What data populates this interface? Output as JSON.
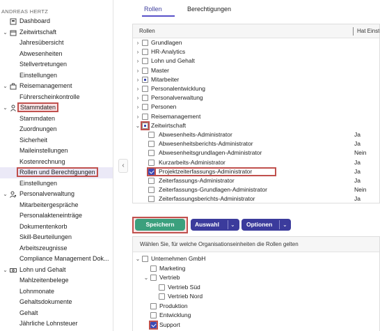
{
  "user": {
    "name": "ANDREAS HERTZ"
  },
  "sidebar": {
    "items": [
      {
        "label": "Dashboard",
        "icon": "dashboard-icon",
        "level": "top"
      },
      {
        "label": "Zeitwirtschaft",
        "icon": "calendar-clock-icon",
        "level": "top",
        "expandable": true
      },
      {
        "label": "Jahresübersicht",
        "level": "sub"
      },
      {
        "label": "Abwesenheiten",
        "level": "sub"
      },
      {
        "label": "Stellvertretungen",
        "level": "sub"
      },
      {
        "label": "Einstellungen",
        "level": "sub"
      },
      {
        "label": "Reisemanagement",
        "icon": "suitcase-icon",
        "level": "top",
        "expandable": true
      },
      {
        "label": "Führerscheinkontrolle",
        "level": "sub"
      },
      {
        "label": "Stammdaten",
        "icon": "person-icon",
        "level": "top",
        "expandable": true,
        "highlight": true
      },
      {
        "label": "Stammdaten",
        "level": "sub"
      },
      {
        "label": "Zuordnungen",
        "level": "sub"
      },
      {
        "label": "Sicherheit",
        "level": "sub"
      },
      {
        "label": "Maileinstellungen",
        "level": "sub"
      },
      {
        "label": "Kostenrechnung",
        "level": "sub"
      },
      {
        "label": "Rollen und Berechtigungen",
        "level": "sub",
        "selected": true
      },
      {
        "label": "Einstellungen",
        "level": "sub"
      },
      {
        "label": "Personalverwaltung",
        "icon": "person-settings-icon",
        "level": "top",
        "expandable": true
      },
      {
        "label": "Mitarbeitergespräche",
        "level": "sub"
      },
      {
        "label": "Personalakteneinträge",
        "level": "sub"
      },
      {
        "label": "Dokumentenkorb",
        "level": "sub"
      },
      {
        "label": "Skill-Beurteilungen",
        "level": "sub"
      },
      {
        "label": "Arbeitszeugnisse",
        "level": "sub"
      },
      {
        "label": "Compliance Management Dok...",
        "level": "sub"
      },
      {
        "label": "Lohn und Gehalt",
        "icon": "money-icon",
        "level": "top",
        "expandable": true
      },
      {
        "label": "Mahlzeitenbelege",
        "level": "sub"
      },
      {
        "label": "Lohnmonate",
        "level": "sub"
      },
      {
        "label": "Gehaltsdokumente",
        "level": "sub"
      },
      {
        "label": "Gehalt",
        "level": "sub"
      },
      {
        "label": "Jährliche Lohnsteuer",
        "level": "sub"
      }
    ]
  },
  "collapse": {
    "glyph": "‹"
  },
  "tabs": [
    {
      "label": "Rollen",
      "active": true
    },
    {
      "label": "Berechtigungen",
      "active": false
    }
  ],
  "roles_table": {
    "col_roles": "Rollen",
    "col_flag": "Hat Einst",
    "groups": [
      {
        "label": "Grundlagen",
        "state": "unchecked"
      },
      {
        "label": "HR-Analytics",
        "state": "unchecked"
      },
      {
        "label": "Lohn und Gehalt",
        "state": "unchecked"
      },
      {
        "label": "Master",
        "state": "unchecked"
      },
      {
        "label": "Mitarbeiter",
        "state": "partial"
      },
      {
        "label": "Personalentwicklung",
        "state": "unchecked"
      },
      {
        "label": "Personalverwaltung",
        "state": "unchecked"
      },
      {
        "label": "Personen",
        "state": "unchecked"
      },
      {
        "label": "Reisemanagement",
        "state": "unchecked"
      },
      {
        "label": "Zeitwirtschaft",
        "state": "partial",
        "expanded": true
      }
    ],
    "children": [
      {
        "label": "Abwesenheits-Administrator",
        "value": "Ja",
        "state": "unchecked"
      },
      {
        "label": "Abwesenheitsberichts-Administrator",
        "value": "Ja",
        "state": "unchecked"
      },
      {
        "label": "Abwesenheitsgrundlagen-Administrator",
        "value": "Nein",
        "state": "unchecked"
      },
      {
        "label": "Kurzarbeits-Administrator",
        "value": "Ja",
        "state": "unchecked"
      },
      {
        "label": "Projektzeiterfassungs-Administrator",
        "value": "Ja",
        "state": "checked"
      },
      {
        "label": "Zeiterfassungs-Administrator",
        "value": "Ja",
        "state": "unchecked"
      },
      {
        "label": "Zeiterfassungs-Grundlagen-Administrator",
        "value": "Nein",
        "state": "unchecked"
      },
      {
        "label": "Zeiterfassungsberichts-Administrator",
        "value": "Ja",
        "state": "unchecked"
      }
    ]
  },
  "toolbar": {
    "save_label": "Speichern",
    "selection_label": "Auswahl",
    "options_label": "Optionen",
    "dropdown_glyph": "⌄"
  },
  "org_units": {
    "header": "Wählen Sie, für welche Organisationseinheiten die Rollen gelten",
    "items": [
      {
        "label": "Unternehmen GmbH",
        "state": "unchecked"
      },
      {
        "label": "Marketing",
        "state": "unchecked"
      },
      {
        "label": "Vertrieb",
        "state": "unchecked"
      },
      {
        "label": "Vertrieb Süd",
        "state": "unchecked"
      },
      {
        "label": "Vertrieb Nord",
        "state": "unchecked"
      },
      {
        "label": "Produktion",
        "state": "unchecked"
      },
      {
        "label": "Entwicklung",
        "state": "unchecked"
      },
      {
        "label": "Support",
        "state": "checked"
      }
    ]
  },
  "colors": {
    "accent": "#3b3b9c",
    "save": "#3ba07d",
    "highlight": "#c0504d",
    "selected_bg": "#ebe9f7"
  }
}
